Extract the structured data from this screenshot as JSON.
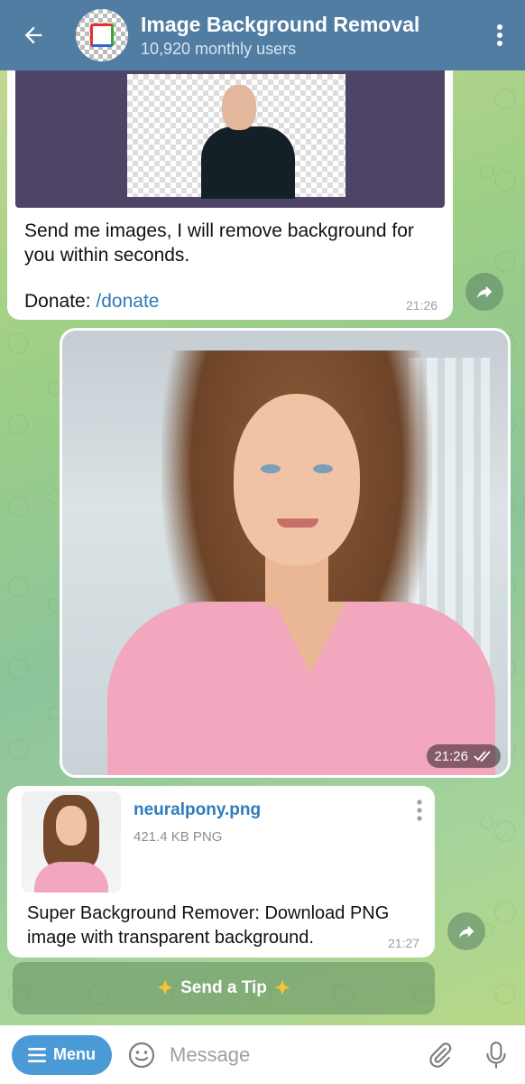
{
  "header": {
    "title": "Image Background Removal",
    "subtitle": "10,920 monthly users"
  },
  "messages": {
    "intro": {
      "text": "Send me images, I will remove background for you within seconds.",
      "donate_label": "Donate: ",
      "donate_link": "/donate",
      "time": "21:26"
    },
    "photo": {
      "time": "21:26"
    },
    "file": {
      "name": "neuralpony.png",
      "meta": "421.4 KB PNG",
      "text": "Super Background Remover: Download PNG image with transparent background.",
      "time": "21:27"
    }
  },
  "tip_button": {
    "label": "Send a Tip"
  },
  "input_bar": {
    "menu_label": "Menu",
    "placeholder": "Message"
  },
  "colors": {
    "header_bg": "#527da3",
    "link": "#2f7bbd",
    "menu_button": "#4a9ad6"
  }
}
